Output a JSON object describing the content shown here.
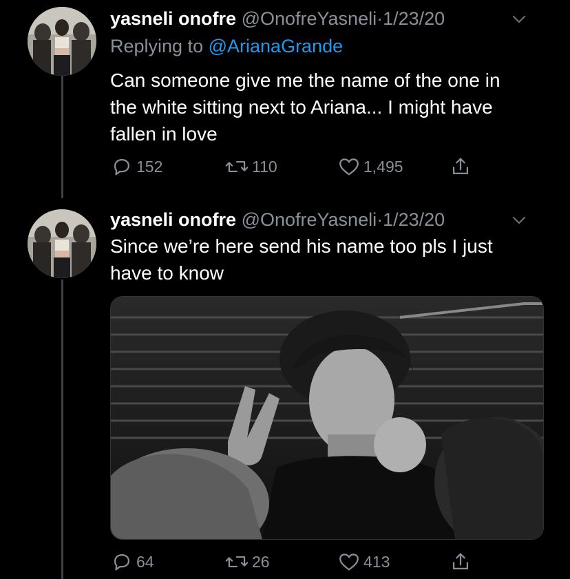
{
  "tweets": [
    {
      "name": "yasneli onofre",
      "handle": "@OnofreYasneli",
      "dot": "·",
      "date": "1/23/20",
      "reply_prefix": "Replying to",
      "reply_mention": "@ArianaGrande",
      "text_lines": [
        "Can someone give me the name of the one in",
        "the white sitting next to Ariana... I might have",
        "fallen in love"
      ],
      "replies": "152",
      "retweets": "110",
      "likes": "1,495"
    },
    {
      "name": "yasneli onofre",
      "handle": "@OnofreYasneli",
      "dot": "·",
      "date": "1/23/20",
      "text_lines": [
        "Since we’re here send his name too pls I just",
        "have to know"
      ],
      "replies": "64",
      "retweets": "26",
      "likes": "413"
    }
  ],
  "icons": {
    "reply": "reply-icon",
    "retweet": "retweet-icon",
    "like": "heart-icon",
    "share": "share-icon",
    "caret": "chevron-down-icon"
  },
  "colors": {
    "background": "#000000",
    "primary_text": "#ffffff",
    "secondary_text": "#8a9099",
    "link": "#1d9bf0",
    "thread_line": "#3d4148"
  }
}
